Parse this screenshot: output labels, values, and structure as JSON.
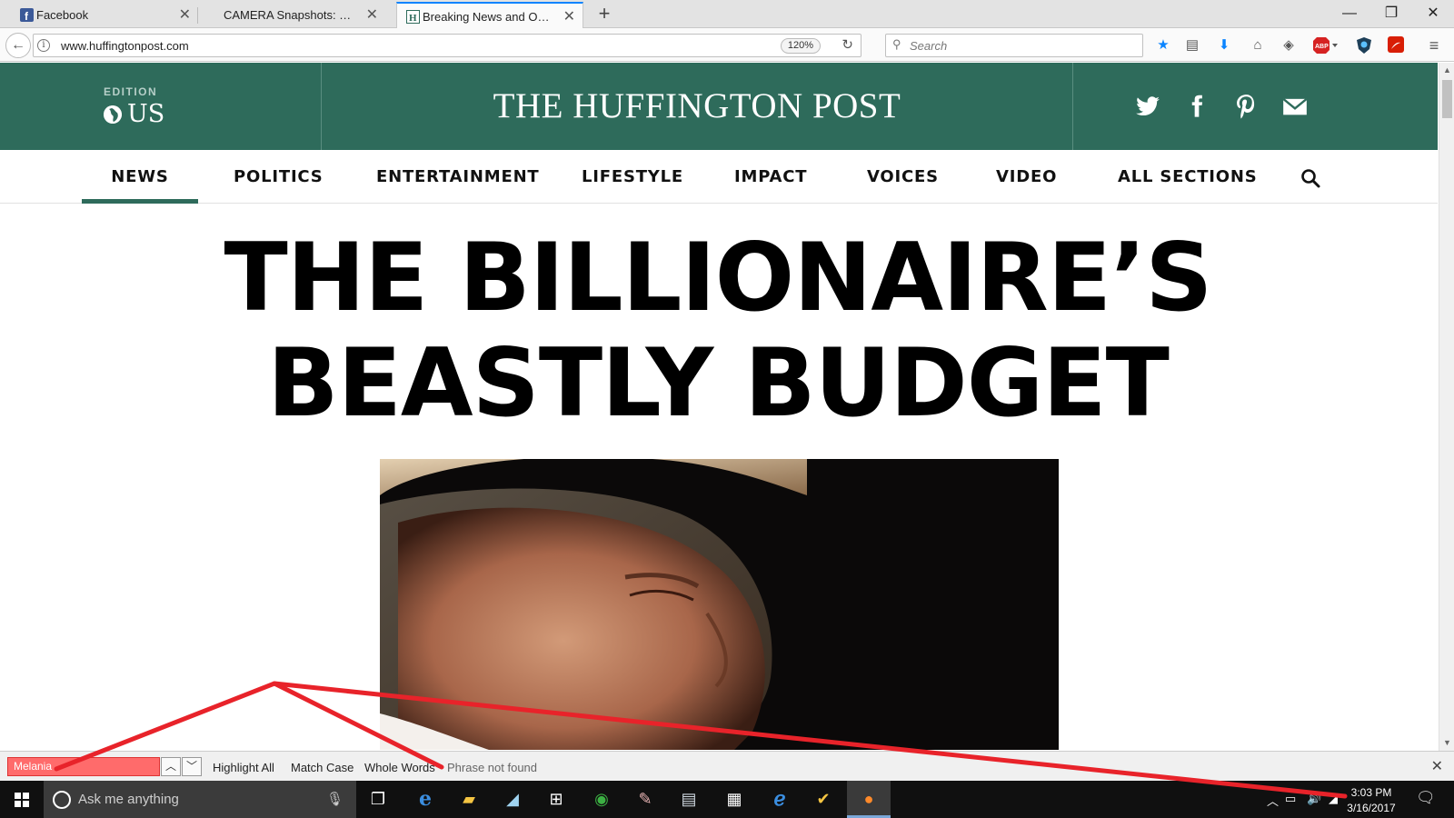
{
  "browser": {
    "tabs": [
      {
        "title": "Facebook",
        "active": false
      },
      {
        "title": "CAMERA Snapshots: Huffingt...",
        "active": false
      },
      {
        "title": "Breaking News and Opini...",
        "active": true
      }
    ],
    "url": "www.huffingtonpost.com",
    "zoom": "120%",
    "search_placeholder": "Search",
    "toolbar_icons": [
      "bookmark-star-icon",
      "reading-list-icon",
      "download-icon",
      "home-icon",
      "pocket-icon",
      "adblock-icon",
      "shield-extension-icon",
      "acrobat-icon",
      "hamburger-menu-icon"
    ]
  },
  "site": {
    "edition_label": "EDITION",
    "edition_value": "US",
    "logo": "THE HUFFINGTON POST",
    "social": [
      "twitter-icon",
      "facebook-icon",
      "pinterest-icon",
      "email-icon"
    ],
    "accent_color": "#2e6b5b",
    "sections": [
      "NEWS",
      "POLITICS",
      "ENTERTAINMENT",
      "LIFESTYLE",
      "IMPACT",
      "VOICES",
      "VIDEO",
      "ALL SECTIONS"
    ],
    "active_section": "NEWS",
    "headline_line1": "THE BILLIONAIRE’S",
    "headline_line2": "BEASTLY BUDGET"
  },
  "findbar": {
    "query": "Melania",
    "highlight_all": "Highlight All",
    "match_case": "Match Case",
    "whole_words": "Whole Words",
    "status": "Phrase not found"
  },
  "taskbar": {
    "cortana_placeholder": "Ask me anything",
    "time": "3:03 PM",
    "date": "3/16/2017"
  }
}
